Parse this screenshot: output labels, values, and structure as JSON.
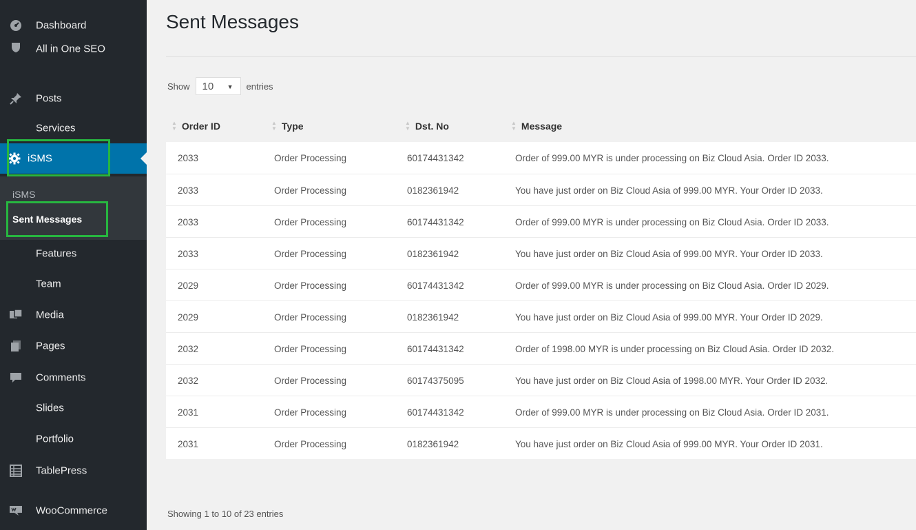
{
  "sidebar": {
    "items": [
      {
        "label": "Dashboard",
        "icon": "dashboard-icon"
      },
      {
        "label": "All in One SEO",
        "icon": "shield-icon"
      },
      {
        "label": "Posts",
        "icon": "pin-icon"
      },
      {
        "label": "Services",
        "icon": ""
      },
      {
        "label": "iSMS",
        "icon": "gear-icon"
      },
      {
        "label": "Features",
        "icon": ""
      },
      {
        "label": "Team",
        "icon": ""
      },
      {
        "label": "Media",
        "icon": "media-icon"
      },
      {
        "label": "Pages",
        "icon": "pages-icon"
      },
      {
        "label": "Comments",
        "icon": "comment-icon"
      },
      {
        "label": "Slides",
        "icon": ""
      },
      {
        "label": "Portfolio",
        "icon": ""
      },
      {
        "label": "TablePress",
        "icon": "table-icon"
      },
      {
        "label": "WooCommerce",
        "icon": "woo-icon"
      }
    ],
    "submenu": [
      {
        "label": "iSMS"
      },
      {
        "label": "Sent Messages"
      }
    ]
  },
  "main": {
    "title": "Sent Messages",
    "length": {
      "show": "Show",
      "value": "10",
      "entries": "entries"
    },
    "columns": [
      "Order ID",
      "Type",
      "Dst. No",
      "Message"
    ],
    "rows": [
      [
        "2033",
        "Order Processing",
        "60174431342",
        "Order of 999.00 MYR is under processing on Biz Cloud Asia. Order ID 2033."
      ],
      [
        "2033",
        "Order Processing",
        "0182361942",
        "You have just order on Biz Cloud Asia of 999.00 MYR. Your Order ID 2033."
      ],
      [
        "2033",
        "Order Processing",
        "60174431342",
        "Order of 999.00 MYR is under processing on Biz Cloud Asia. Order ID 2033."
      ],
      [
        "2033",
        "Order Processing",
        "0182361942",
        "You have just order on Biz Cloud Asia of 999.00 MYR. Your Order ID 2033."
      ],
      [
        "2029",
        "Order Processing",
        "60174431342",
        "Order of 999.00 MYR is under processing on Biz Cloud Asia. Order ID 2029."
      ],
      [
        "2029",
        "Order Processing",
        "0182361942",
        "You have just order on Biz Cloud Asia of 999.00 MYR. Your Order ID 2029."
      ],
      [
        "2032",
        "Order Processing",
        "60174431342",
        "Order of 1998.00 MYR is under processing on Biz Cloud Asia. Order ID 2032."
      ],
      [
        "2032",
        "Order Processing",
        "60174375095",
        "You have just order on Biz Cloud Asia of 1998.00 MYR. Your Order ID 2032."
      ],
      [
        "2031",
        "Order Processing",
        "60174431342",
        "Order of 999.00 MYR is under processing on Biz Cloud Asia. Order ID 2031."
      ],
      [
        "2031",
        "Order Processing",
        "0182361942",
        "You have just order on Biz Cloud Asia of 999.00 MYR. Your Order ID 2031."
      ]
    ],
    "info": "Showing 1 to 10 of 23 entries"
  },
  "colors": {
    "sidebar_bg": "#23282d",
    "active_bg": "#0073aa",
    "highlight": "#27b640"
  }
}
